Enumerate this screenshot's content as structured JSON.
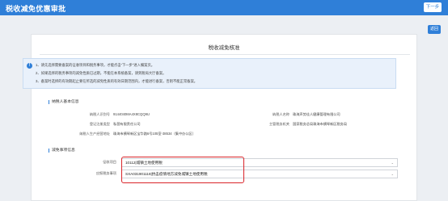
{
  "header": {
    "title": "税收减免优惠审批",
    "next_label": "下一步"
  },
  "back_label": "返回",
  "page_title": "税收减免核准",
  "notice": {
    "lines": [
      "1、请先选择需要备案的征收项目和税务事项，才能点击“下一步”进入備案页。",
      "2、如果选择的税务事项的减免性质已过期，不能在本系统备案，请到税局大厅备案。",
      "3、备案时选择的有效期起止要在所选的减免性质的有效日期范围内，才能进行备案，否则不能正常备案。"
    ]
  },
  "taxpayer": {
    "section_title": "纳税人基本信息",
    "fields": [
      {
        "label": "纳税人识别号",
        "value": "9144040MA4X8CQQ9U"
      },
      {
        "label": "纳税人名称",
        "value": "珠海声势佳人健康管理有限公司"
      },
      {
        "label": "登记注册类型",
        "value": "私营有限责任公司"
      },
      {
        "label": "主管税务机关",
        "value": "国家税务总局珠海市横琴新区税务局"
      },
      {
        "label": "纳税人生产经营地址",
        "value": "珠海市横琴新区宝华路6号105室-38534（集中办公区）"
      }
    ]
  },
  "reduction": {
    "section_title": "减免事项信息",
    "fields": [
      {
        "label": "征收项目",
        "value": "10112|城镇土地使用税"
      },
      {
        "label": "应报税务事项",
        "value": "SXA031901118|抗击疫情地方减免城镇土地使用税"
      }
    ]
  }
}
